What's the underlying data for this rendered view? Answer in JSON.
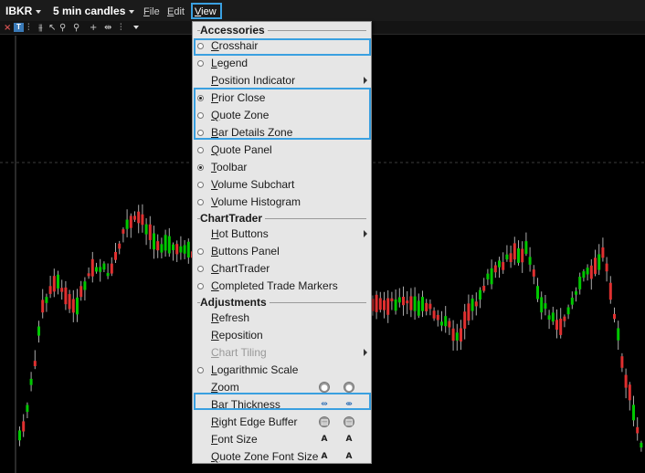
{
  "titlebar": {
    "symbol": "IBKR",
    "chart_type": "5 min candles",
    "menus": [
      "File",
      "Edit",
      "View"
    ]
  },
  "toolbar": {
    "icons": [
      "close-icon",
      "chart-type-icon",
      "bars-icon",
      "pointer-icon",
      "zoom-in-icon",
      "zoom-out-icon",
      "crosshair-icon",
      "bar-thickness-icon",
      "dropdown-icon"
    ]
  },
  "view_menu": {
    "sections": [
      {
        "header": "Accessories",
        "items": [
          {
            "label": "Crosshair",
            "radio": true,
            "checked": false
          },
          {
            "label": "Legend",
            "radio": true,
            "checked": false
          },
          {
            "label": "Position Indicator",
            "radio": false,
            "submenu": true
          },
          {
            "label": "Prior Close",
            "radio": true,
            "checked": true
          },
          {
            "label": "Quote Zone",
            "radio": true,
            "checked": false
          },
          {
            "label": "Bar Details Zone",
            "radio": true,
            "checked": false
          },
          {
            "label": "Quote Panel",
            "radio": true,
            "checked": false
          },
          {
            "label": "Toolbar",
            "radio": true,
            "checked": true
          },
          {
            "label": "Volume Subchart",
            "radio": true,
            "checked": false
          },
          {
            "label": "Volume Histogram",
            "radio": true,
            "checked": false
          }
        ]
      },
      {
        "header": "ChartTrader",
        "items": [
          {
            "label": "Hot Buttons",
            "radio": false,
            "submenu": true
          },
          {
            "label": "Buttons Panel",
            "radio": true,
            "checked": false
          },
          {
            "label": "ChartTrader",
            "radio": true,
            "checked": false
          },
          {
            "label": "Completed Trade Markers",
            "radio": true,
            "checked": false
          }
        ]
      },
      {
        "header": "Adjustments",
        "items": [
          {
            "label": "Refresh",
            "radio": false
          },
          {
            "label": "Reposition",
            "radio": false
          },
          {
            "label": "Chart Tiling",
            "radio": false,
            "submenu": true,
            "disabled": true
          },
          {
            "label": "Logarithmic Scale",
            "radio": true,
            "checked": false
          },
          {
            "label": "Zoom",
            "radio": false,
            "controls": [
              "zoom-in-icon",
              "zoom-out-icon"
            ]
          },
          {
            "label": "Bar Thickness",
            "radio": false,
            "controls": [
              "thicker-bars-icon",
              "thinner-bars-icon"
            ]
          },
          {
            "label": "Right Edge Buffer",
            "radio": false,
            "controls": [
              "buffer-increase-icon",
              "buffer-decrease-icon"
            ]
          },
          {
            "label": "Font Size",
            "radio": false,
            "controls": [
              "font-increase-icon",
              "font-decrease-icon"
            ]
          },
          {
            "label": "Quote Zone Font Size",
            "radio": false,
            "controls": [
              "quote-font-increase-icon",
              "quote-font-decrease-icon"
            ]
          }
        ]
      }
    ]
  },
  "chart": {
    "up_color": "#00c800",
    "down_color": "#e03030",
    "background": "#000000",
    "grid_color": "#3c3c3c"
  },
  "colors": {
    "highlight": "#3aa0e0",
    "menu_bg": "#e6e6e6"
  }
}
